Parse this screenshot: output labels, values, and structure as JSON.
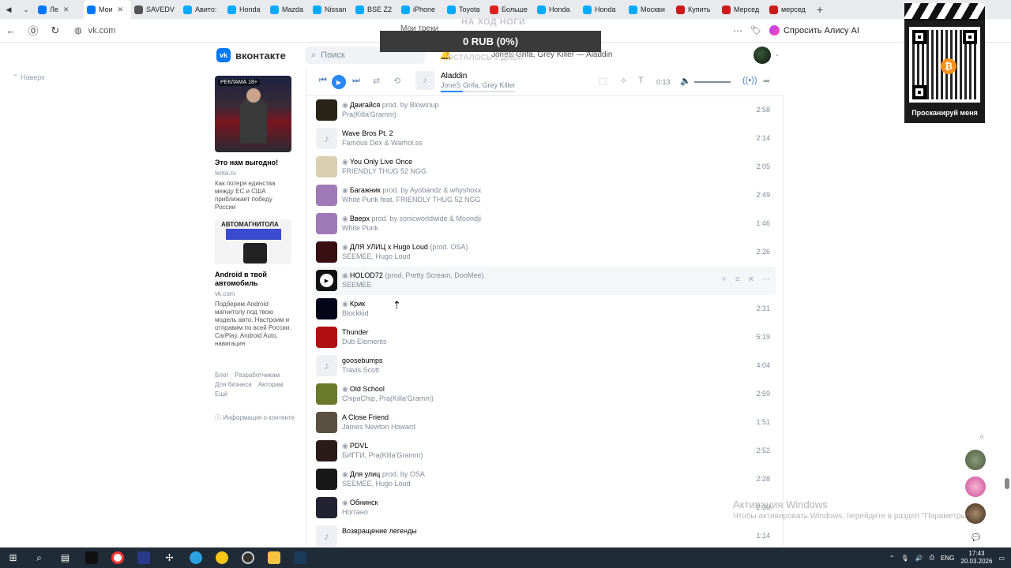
{
  "browser": {
    "tabs": [
      {
        "label": "Ле",
        "color": "#0077ff"
      },
      {
        "label": "Мои",
        "color": "#0077ff",
        "active": true
      },
      {
        "label": "SAVEDV",
        "color": "#555555"
      },
      {
        "label": "Авито:",
        "color": "#00aaff"
      },
      {
        "label": "Honda",
        "color": "#00aaff"
      },
      {
        "label": "Mazda",
        "color": "#00aaff"
      },
      {
        "label": "Nissan",
        "color": "#00aaff"
      },
      {
        "label": "BSE Z2",
        "color": "#00aaff"
      },
      {
        "label": "iPhone",
        "color": "#00aaff"
      },
      {
        "label": "Toyota",
        "color": "#00aaff"
      },
      {
        "label": "Больше",
        "color": "#e02020"
      },
      {
        "label": "Honda",
        "color": "#00aaff"
      },
      {
        "label": "Honda",
        "color": "#00aaff"
      },
      {
        "label": "Москви",
        "color": "#00aaff"
      },
      {
        "label": "Купить",
        "color": "#cc1a1a"
      },
      {
        "label": "Мерсед",
        "color": "#cc1a1a"
      },
      {
        "label": "мерсед",
        "color": "#cc1a1a"
      }
    ],
    "url": "vk.com",
    "alice_label": "Спросить Алису AI"
  },
  "vk": {
    "logo_text": "вконтакте",
    "search_placeholder": "Поиск",
    "header_player_text": "JoneS Grifa, Grey Killer — Aladdin"
  },
  "overlay": {
    "top_text": "НА ХОД НОГИ",
    "my_tracks": "Мои треки",
    "donation": "0 RUB (0%)",
    "remaining": "ОСТАЛОСЬ 5 ДНЕЙ",
    "qr_caption": "Просканируй меня"
  },
  "left": {
    "up_label": "Наверх",
    "ad1": {
      "badge": "РЕКЛАМА 18+",
      "title": "Это нам выгодно!",
      "source": "lenta.ru",
      "desc": "Как потеря единства между ЕС и США приближает победу России"
    },
    "ad2": {
      "img_text": "АВТОМАГНИТОЛА",
      "title": "Android в твой автомобиль",
      "source": "vk.com",
      "desc": "Подберем Android магнитолу под твою модель авто. Настроим и отправим по всей России. CarPlay, Android Auto, навигация."
    },
    "footer_links": [
      "Блог",
      "Разработчикам",
      "Для бизнеса",
      "Авторам",
      "Ещё"
    ],
    "info": "Информация о контенте"
  },
  "player": {
    "title": "Aladdin",
    "artist": "JoneS Grifa, Grey Killer",
    "time": "0:13",
    "progress": 0.3
  },
  "tracks": [
    {
      "title": "Двигайся",
      "sub": "prod. by Blowinup",
      "artist": "Pra(Killa'Gramm)",
      "duration": "2:58",
      "lock": true,
      "thumb": "#2a2418"
    },
    {
      "title": "Wave Bros Pt. 2",
      "sub": "",
      "artist": "Famous Dex & Warhol.ss",
      "duration": "2:14",
      "lock": false,
      "thumb": "none"
    },
    {
      "title": "You Only Live Once",
      "sub": "",
      "artist": "FRIENDLY THUG 52 NGG",
      "duration": "2:05",
      "lock": true,
      "thumb": "#d8d0b0"
    },
    {
      "title": "Багажник",
      "sub": "prod. by Ayobandz & whyshoxx",
      "artist": "White Punk feat. FRIENDLY THUG 52 NGG",
      "duration": "2:49",
      "lock": true,
      "thumb": "#a07ab8"
    },
    {
      "title": "Вверх",
      "sub": "prod. by sonicworldwide & Moondji",
      "artist": "White Punk",
      "duration": "1:46",
      "lock": true,
      "thumb": "#a07ab8"
    },
    {
      "title": "ДЛЯ УЛИЦ x Hugo Loud",
      "sub": "(prod. OSA)",
      "artist": "SEEMEE, Hugo Loud",
      "duration": "2:26",
      "lock": true,
      "thumb": "#3a0f14"
    },
    {
      "title": "HOLOD72",
      "sub": "(prod. Pretty Scream, DooMee)",
      "artist": "SEEMEE",
      "duration": "",
      "lock": true,
      "thumb": "#111111",
      "hover": true
    },
    {
      "title": "Крик",
      "sub": "",
      "artist": "Blockkid",
      "duration": "2:31",
      "lock": true,
      "thumb": "#05051a"
    },
    {
      "title": "Thunder",
      "sub": "",
      "artist": "Dub Elements",
      "duration": "5:19",
      "lock": false,
      "thumb": "#b01010"
    },
    {
      "title": "goosebumps",
      "sub": "",
      "artist": "Travis Scott",
      "duration": "4:04",
      "lock": false,
      "thumb": "none"
    },
    {
      "title": "Old School",
      "sub": "",
      "artist": "ChipaChip, Pra(Killa'Gramm)",
      "duration": "2:59",
      "lock": true,
      "thumb": "#6a7a2a"
    },
    {
      "title": "A Close Friend",
      "sub": "",
      "artist": "James Newton Howard",
      "duration": "1:51",
      "lock": false,
      "thumb": "#5a5040"
    },
    {
      "title": "PDVL",
      "sub": "",
      "artist": "БИГГИ, Pra(Killa'Gramm)",
      "duration": "2:52",
      "lock": true,
      "thumb": "#2a1a1a"
    },
    {
      "title": "Для улиц",
      "sub": "prod. by OSA",
      "artist": "SEEMEE, Hugo Loud",
      "duration": "2:28",
      "lock": true,
      "thumb": "#181818"
    },
    {
      "title": "Обнинск",
      "sub": "",
      "artist": "Ноггано",
      "duration": "2:30",
      "lock": true,
      "thumb": "#222233"
    },
    {
      "title": "Возвращение легенды",
      "sub": "",
      "artist": "",
      "duration": "1:14",
      "lock": false,
      "thumb": "none"
    }
  ],
  "watermark": {
    "line1": "Активация Windows",
    "line2": "Чтобы активировать Windows, перейдите в раздел \"Параметры\"."
  },
  "taskbar": {
    "lang": "ENG",
    "time": "17:43",
    "date": "20.03.2026"
  },
  "colors": {
    "accent": "#2787f5",
    "vk_blue": "#0077ff",
    "taskbar": "#1f2b37"
  }
}
